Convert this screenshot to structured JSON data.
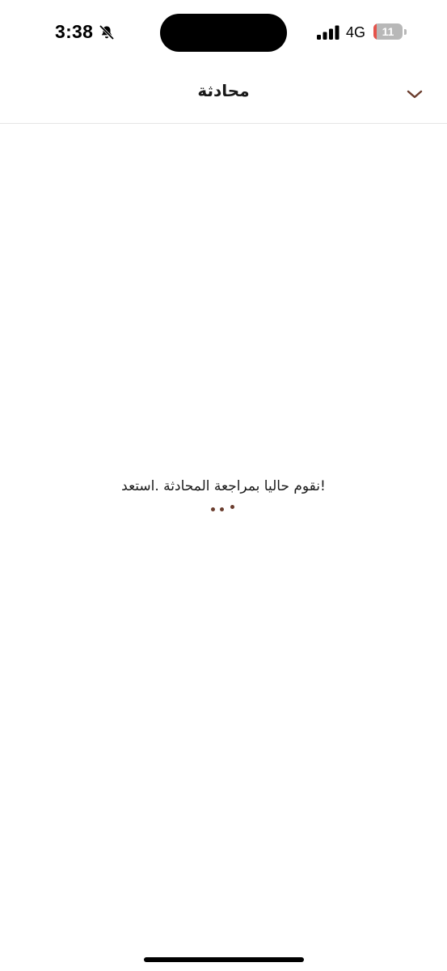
{
  "status_bar": {
    "time": "3:38",
    "network": "4G",
    "battery_level": "11",
    "battery_fraction": 0.11,
    "icons": [
      "bell-slash-icon",
      "signal-bars-icon",
      "battery-icon"
    ]
  },
  "header": {
    "title": "محادثة",
    "collapse_icon": "chevron-down-icon"
  },
  "content": {
    "loading_message": "!نقوم حاليا بمراجعة المحادثة .استعد"
  },
  "colors": {
    "accent": "#6b3d2e",
    "battery_low": "#e5534b"
  }
}
